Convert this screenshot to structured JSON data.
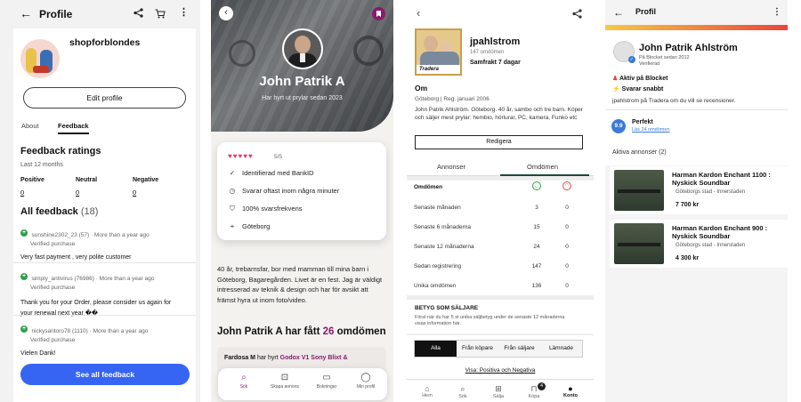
{
  "ebay": {
    "header_title": "Profile",
    "shop_name": "shopforblondes",
    "edit_profile": "Edit profile",
    "tab_about": "About",
    "tab_feedback": "Feedback",
    "ratings_title": "Feedback ratings",
    "ratings_period": "Last 12 months",
    "positive_label": "Positive",
    "positive_value": "0",
    "neutral_label": "Neutral",
    "neutral_value": "0",
    "negative_label": "Negative",
    "negative_value": "0",
    "all_feedback_label": "All feedback",
    "all_feedback_count": "(18)",
    "feedback": [
      {
        "user": "sunshine2302_23 (57) · More than a year ago",
        "verified": "Verified purchase",
        "text": "Very fast payment , very polite customer"
      },
      {
        "user": "simply_antivirus (76986) · More than a year ago",
        "verified": "Verified purchase",
        "text": "Thank you for your Order, please consider us again for your renewal next year ��"
      },
      {
        "user": "nickysantoro78 (1110) · More than a year ago",
        "verified": "Verified purchase",
        "text": "Vielen Dank!"
      }
    ],
    "see_all": "See all feedback"
  },
  "tradera_profile": {
    "name": "John Patrik A",
    "subtitle": "Har hyrt ut prylar sedan 2023",
    "rating_text": "5/5",
    "stars": 5,
    "items": [
      {
        "icon": "check-circle-icon",
        "text": "Identifierad med BankID"
      },
      {
        "icon": "clock-icon",
        "text": "Svarar oftast inom några minuter"
      },
      {
        "icon": "shield-icon",
        "text": "100% svarsfrekvens"
      },
      {
        "icon": "location-icon",
        "text": "Göteborg"
      }
    ],
    "bio": "40 år, trebarnsfar, bor med mamman till mina barn i Göteborg, Bagaregården. Livet är en fest. Jag är väldigt intresserad av teknik & design och har för avsikt att främst hyra ut inom foto/video.",
    "reviews_prefix": "John Patrik A har fått",
    "reviews_count": "26",
    "reviews_suffix": "omdömen",
    "review_preview_name": "Fardosa M",
    "review_preview_mid": "har hyrt",
    "review_preview_item": "Godox V1 Sony Blixt &",
    "nav": [
      "Sök",
      "Skapa annons",
      "Bokningar",
      "Min profil"
    ],
    "accent": "#8a1a6e"
  },
  "tradera": {
    "username": "jpahlstrom",
    "reviews_small": "147 omdömen",
    "shipping": "Samfrakt 7 dagar",
    "avatar_label": "Tradera",
    "about_title": "Om",
    "location_line": "Göteborg | Reg. januari 2006",
    "about_text": "John Patrik Ahlström. Göteborg. 40 år, sambo och tre barn. Köper och säljer mest prylar: hembio, hörlurar, PC, kamera, Funko etc",
    "edit_button": "Redigera",
    "tab_ads": "Annonser",
    "tab_reviews": "Omdömen",
    "table_header": "Omdömen",
    "rows": [
      {
        "label": "Senaste månaden",
        "pos": "3",
        "neg": "0"
      },
      {
        "label": "Senaste 6 månaderna",
        "pos": "15",
        "neg": "0"
      },
      {
        "label": "Senaste 12 månaderna",
        "pos": "24",
        "neg": "0"
      },
      {
        "label": "Sedan registrering",
        "pos": "147",
        "neg": "0"
      },
      {
        "label": "Unika omdömen",
        "pos": "136",
        "neg": "0"
      }
    ],
    "seller_grade_title": "BETYG SOM SÄLJARE",
    "seller_grade_text": "Först när du har 5 st unika säljbetyg under de senaste 12 månaderna visas information här.",
    "filters": [
      "Alla",
      "Från köpare",
      "Från säljare",
      "Lämnade"
    ],
    "show_link": "Visa: Positiva och Negativa",
    "nav": [
      "Hem",
      "Sök",
      "Sälja",
      "Köpa",
      "Konto"
    ],
    "nav_badge": "4"
  },
  "blocket": {
    "header_title": "Profil",
    "name": "John Patrik Ahlström",
    "since": "På Blocket sedan 2012",
    "verified": "Verifierad",
    "active": "Aktiv på Blocket",
    "responds": "Svarar snabbt",
    "ask_text": "jpahlstrom på Tradera om du vill se recensioner.",
    "score": "9.9",
    "score_label": "Perfekt",
    "score_link": "Läs 24 omdömen",
    "active_ads": "Aktiva annonser (2)",
    "ads": [
      {
        "title": "Harman Kardon Enchant 1100 : Nyskick Soundbar",
        "location": "Göteborgs stad - Innerstaden",
        "price": "7 700 kr"
      },
      {
        "title": "Harman Kardon Enchant 900 : Nyskick Soundbar",
        "location": "Göteborgs stad - Innerstaden",
        "price": "4 300 kr"
      }
    ]
  }
}
